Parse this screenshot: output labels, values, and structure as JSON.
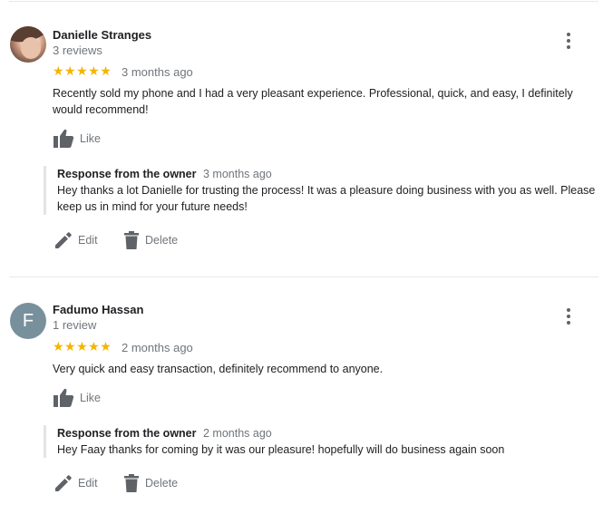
{
  "reviews": [
    {
      "name": "Danielle Stranges",
      "review_count": "3 reviews",
      "stars": "★★★★★",
      "rating": 5,
      "time": "3 months ago",
      "text": "Recently sold my phone and I had a very pleasant experience. Professional, quick, and easy, I definitely would recommend!",
      "like_label": "Like",
      "response": {
        "owner_label": "Response from the owner",
        "time": "3 months ago",
        "text": "Hey thanks a lot Danielle for trusting the process! It was a pleasure doing business with you as well. Please keep us in mind for your future needs!"
      },
      "edit_label": "Edit",
      "delete_label": "Delete"
    },
    {
      "name": "Fadumo Hassan",
      "avatar_letter": "F",
      "review_count": "1 review",
      "stars": "★★★★★",
      "rating": 5,
      "time": "2 months ago",
      "text": "Very quick and easy transaction, definitely recommend to anyone.",
      "like_label": "Like",
      "response": {
        "owner_label": "Response from the owner",
        "time": "2 months ago",
        "text": "Hey Faay thanks for coming by it was our pleasure! hopefully will do business again soon"
      },
      "edit_label": "Edit",
      "delete_label": "Delete"
    }
  ],
  "colors": {
    "star": "#f4b400",
    "icon": "#5f6368",
    "avatar_letter_bg": "#78909c"
  }
}
